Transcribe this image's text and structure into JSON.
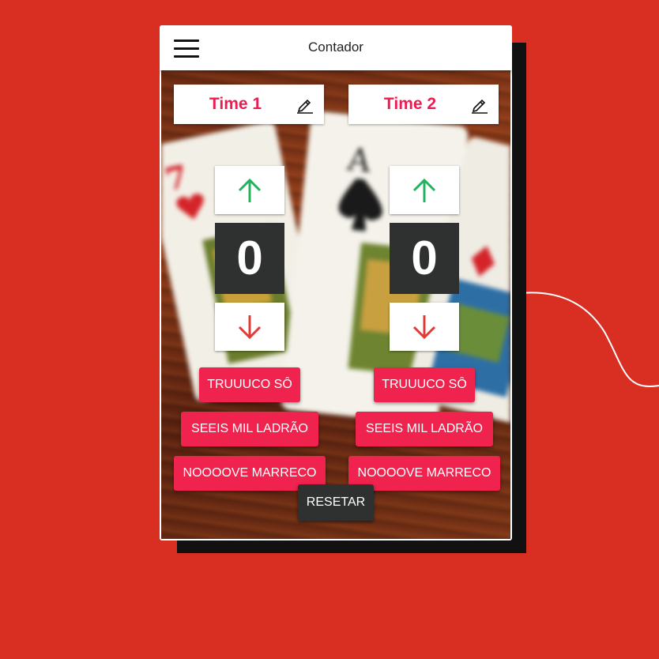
{
  "app": {
    "title": "Contador"
  },
  "colors": {
    "background": "#d92f22",
    "team_name": "#ec1c52",
    "button": "#f0224e",
    "score_box": "#2f3030",
    "arrow_up": "#22b35e",
    "arrow_down": "#e53935"
  },
  "icons": {
    "menu": "hamburger-menu-icon",
    "edit": "pencil-icon",
    "increment": "arrow-up-icon",
    "decrement": "arrow-down-icon"
  },
  "teams": [
    {
      "name": "Time 1",
      "score": "0",
      "buttons": [
        "TRUUUCO SÔ",
        "SEEIS MIL LADRÃO",
        "NOOOOVE MARRECO"
      ]
    },
    {
      "name": "Time 2",
      "score": "0",
      "buttons": [
        "TRUUUCO SÔ",
        "SEEIS MIL LADRÃO",
        "NOOOOVE MARRECO"
      ]
    }
  ],
  "reset_label": "RESETAR"
}
